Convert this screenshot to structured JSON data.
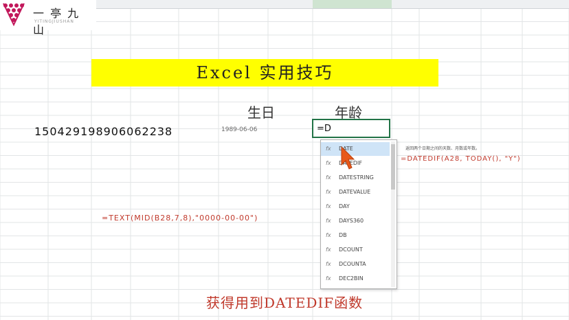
{
  "logo": {
    "text": "一 亭 九 山",
    "sub": "YITINGJIUSHAN"
  },
  "title": "Excel 实用技巧",
  "headers": {
    "birthday": "生日",
    "age": "年龄"
  },
  "row": {
    "id_number": "150429198906062238",
    "birthday": "1989-06-06",
    "age_input": "=D"
  },
  "autocomplete": {
    "items": [
      {
        "label": "DATE"
      },
      {
        "label": "DATEDIF"
      },
      {
        "label": "DATESTRING"
      },
      {
        "label": "DATEVALUE"
      },
      {
        "label": "DAY"
      },
      {
        "label": "DAYS360"
      },
      {
        "label": "DB"
      },
      {
        "label": "DCOUNT"
      },
      {
        "label": "DCOUNTA"
      },
      {
        "label": "DEC2BIN"
      }
    ],
    "tooltip": "返回两个日期之间的天数、月数或年数。"
  },
  "formulas": {
    "right": "=DATEDIF(A28, TODAY(), \"Y\")",
    "left": "=TEXT(MID(B28,7,8),\"0000-00-00\")"
  },
  "caption": "获得用到DATEDIF函数",
  "colors": {
    "title_bg": "#ffff00",
    "accent_red": "#c0392b",
    "cell_border": "#217346",
    "logo_pink": "#c2185b"
  }
}
